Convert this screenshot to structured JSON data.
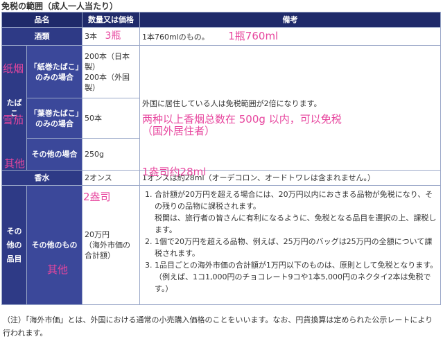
{
  "title": "免税の範囲（成人一人当たり）",
  "header": {
    "col1": "品名",
    "col2": "数量又は価格",
    "col3": "備考"
  },
  "alcohol": {
    "name": "酒類",
    "qty": "3本",
    "note": "1本760mlのもの。",
    "handwrite_qty": "3瓶",
    "handwrite_note": "1瓶760ml"
  },
  "tobacco": {
    "category": "たばこ",
    "items": [
      {
        "name": "「紙巻たばこ」のみの場合",
        "qty_lines": [
          "200本（日本製）",
          "200本（外国製）"
        ],
        "handwrite": "纸烟"
      },
      {
        "name": "「葉巻たばこ」のみの場合",
        "qty_lines": [
          "50本"
        ],
        "handwrite": "雪茄"
      },
      {
        "name": "その他の場合",
        "qty_lines": [
          "250g"
        ],
        "handwrite": "其他"
      }
    ],
    "note": "外国に居住している人は免税範囲が2倍になります。",
    "handwrite_note_1": "两种以上香烟总数在 500g 以内，可以免税",
    "handwrite_note_2": "（国外居住者）"
  },
  "perfume": {
    "name": "香水",
    "qty": "2オンス",
    "note": "1オンスは約28ml（オーデコロン、オードトワレは含まれません。）",
    "handwrite_above": "1盎司约28ml",
    "handwrite_qty": "2盎司"
  },
  "other": {
    "category": "その他の品目",
    "name": "その他のもの",
    "handwrite": "其他",
    "qty_lines": [
      "20万円",
      "（海外市価の合計額）"
    ],
    "notes": [
      {
        "num": "1.",
        "text": "合計額が20万円を超える場合には、20万円以内におさまる品物が免税になり、その残りの品物に課税されます。"
      },
      {
        "num": "",
        "text": "税関は、旅行者の皆さんに有利になるように、免税となる品目を選択の上、課税します。"
      },
      {
        "num": "2.",
        "text": "1個で20万円を超える品物、例えば、25万円のバッグは25万円の全額について課税されます。"
      },
      {
        "num": "3.",
        "text": "1品目ごとの海外市価の合計額が1万円以下のものは、原則として免税となります。（例えば、1コ1,000円のチョコレート9コや1本5,000円のネクタイ2本は免税です。）"
      }
    ]
  },
  "footnote": "（注）「海外市価」とは、外国における通常の小売購入価格のことをいいます。なお、円貨換算は定められた公示レートにより行われます。",
  "colors": {
    "header_bg": "#1f2a6a",
    "cell_bg": "#2e3a86",
    "handwriting": "#e7469e",
    "border": "#9aa7c8"
  }
}
